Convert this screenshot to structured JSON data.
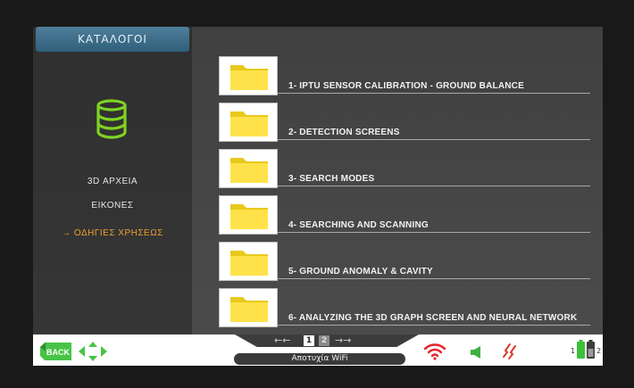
{
  "sidebar": {
    "title": "ΚΑΤΑΛΟΓΟΙ",
    "items": [
      {
        "label": "3D ΑΡΧΕΙΑ",
        "active": false
      },
      {
        "label": "ΕΙΚΟΝΕΣ",
        "active": false
      },
      {
        "label": "→ ΟΔΗΓΙΕΣ ΧΡΗΣΕΩΣ",
        "active": true
      }
    ],
    "icon": "database-icon"
  },
  "folders": [
    {
      "label": "1- IPTU SENSOR CALIBRATION - GROUND BALANCE"
    },
    {
      "label": "2- DETECTION SCREENS"
    },
    {
      "label": "3- SEARCH MODES"
    },
    {
      "label": "4- SEARCHING AND SCANNING"
    },
    {
      "label": "5- GROUND ANOMALY & CAVITY"
    },
    {
      "label": "6- ANALYZING THE 3D GRAPH SCREEN AND NEURAL NETWORK"
    }
  ],
  "statusbar": {
    "back_label": "BACK",
    "pager": {
      "prev": "←←",
      "next": "→→",
      "pages": [
        "1",
        "2"
      ],
      "current": "1"
    },
    "wifi_status": "Αποτυχία WiFi",
    "battery": {
      "left_label": "1",
      "right_label": "2"
    }
  },
  "colors": {
    "accent_active": "#f0a030",
    "db_icon": "#7ed321",
    "wifi_icon": "#e8202a",
    "vibration_icon": "#d83a2c",
    "speaker_icon": "#40b040",
    "back_green": "#47c447"
  }
}
